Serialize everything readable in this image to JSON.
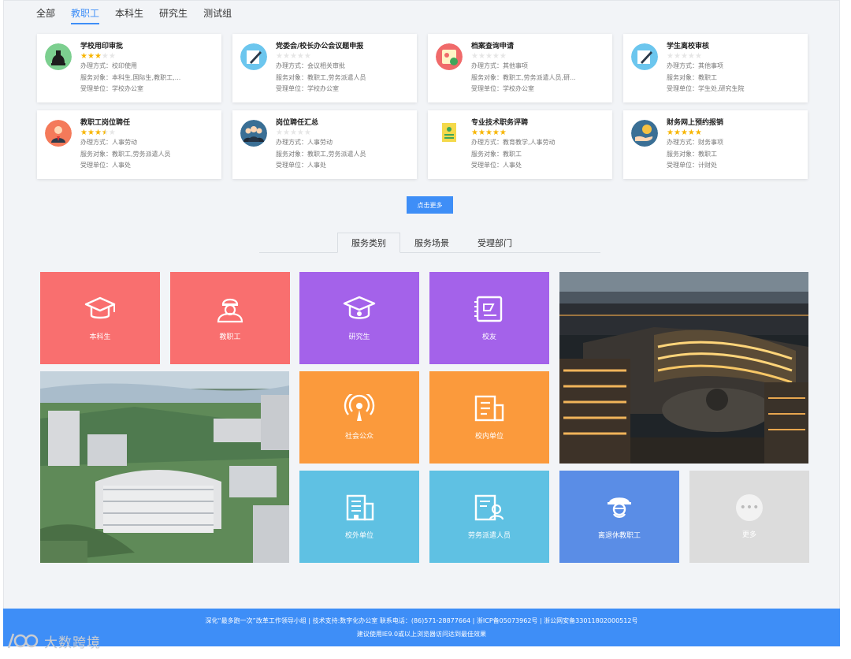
{
  "top_tabs": [
    "全部",
    "教职工",
    "本科生",
    "研究生",
    "测试组"
  ],
  "active_top_tab": 1,
  "cards": [
    {
      "title": "学校用印审批",
      "rating": 3,
      "icon": "seal-stamp-icon",
      "icon_bg": "#7ccf8f",
      "method": "办理方式：校印使用",
      "target": "服务对象：本科生,国际生,教职工,...",
      "dept": "受理单位：学校办公室"
    },
    {
      "title": "党委会/校长办公会议题申报",
      "rating": 0,
      "icon": "pen-write-icon",
      "icon_bg": "#6cc6ee",
      "method": "办理方式：会议相关审批",
      "target": "服务对象：教职工,劳务派遣人员",
      "dept": "受理单位：学校办公室"
    },
    {
      "title": "档案查询申请",
      "rating": 0,
      "icon": "archive-card-icon",
      "icon_bg": "#f06a6a",
      "method": "办理方式：其他事项",
      "target": "服务对象：教职工,劳务派遣人员,研...",
      "dept": "受理单位：学校办公室"
    },
    {
      "title": "学生离校审核",
      "rating": 0,
      "icon": "pen-write-icon",
      "icon_bg": "#6cc6ee",
      "method": "办理方式：其他事项",
      "target": "服务对象：教职工",
      "dept": "受理单位：学生处,研究生院"
    },
    {
      "title": "教职工岗位聘任",
      "rating": 3.5,
      "icon": "staff-person-icon",
      "icon_bg": "#f47a5a",
      "method": "办理方式：人事劳动",
      "target": "服务对象：教职工,劳务派遣人员",
      "dept": "受理单位：人事处"
    },
    {
      "title": "岗位聘任汇总",
      "rating": 0,
      "icon": "team-people-icon",
      "icon_bg": "#3a6f95",
      "method": "办理方式：人事劳动",
      "target": "服务对象：教职工,劳务派遣人员",
      "dept": "受理单位：人事处"
    },
    {
      "title": "专业技术职务评聘",
      "rating": 5,
      "icon": "certificate-icon",
      "icon_bg": "#ffffff",
      "method": "办理方式：教育教学,人事劳动",
      "target": "服务对象：教职工",
      "dept": "受理单位：人事处"
    },
    {
      "title": "财务网上预约报销",
      "rating": 5,
      "icon": "coin-hand-icon",
      "icon_bg": "#3a6f95",
      "method": "办理方式：财务事项",
      "target": "服务对象：教职工",
      "dept": "受理单位：计财处"
    }
  ],
  "more_button": "点击更多",
  "category_tabs": [
    "服务类别",
    "服务场景",
    "受理部门"
  ],
  "active_category_tab": 0,
  "tiles": {
    "undergrad": "本科生",
    "staff": "教职工",
    "graduate": "研究生",
    "alumni": "校友",
    "public": "社会公众",
    "internal": "校内单位",
    "external": "校外单位",
    "dispatch": "劳务派遣人员",
    "retired": "离退休教职工",
    "more": "更多"
  },
  "colors": {
    "accent": "#3e8ef7",
    "tile_red": "#f96f6f",
    "tile_purple": "#a462ea",
    "tile_orange": "#fb9a3c",
    "tile_cyan": "#5fc1e3",
    "tile_blue": "#5a8de6",
    "tile_grey": "#dcdcdc",
    "star": "#f7b500"
  },
  "footer": {
    "line1": "深化“最多跑一次”改革工作领导小组 | 技术支持:数字化办公室 联系电话：(86)571-28877664 | 浙ICP备05073962号 | 浙公网安备33011802000512号",
    "line2": "建议使用IE9.0或以上浏览器访问达到最佳效果"
  },
  "watermark": "大数跨境"
}
